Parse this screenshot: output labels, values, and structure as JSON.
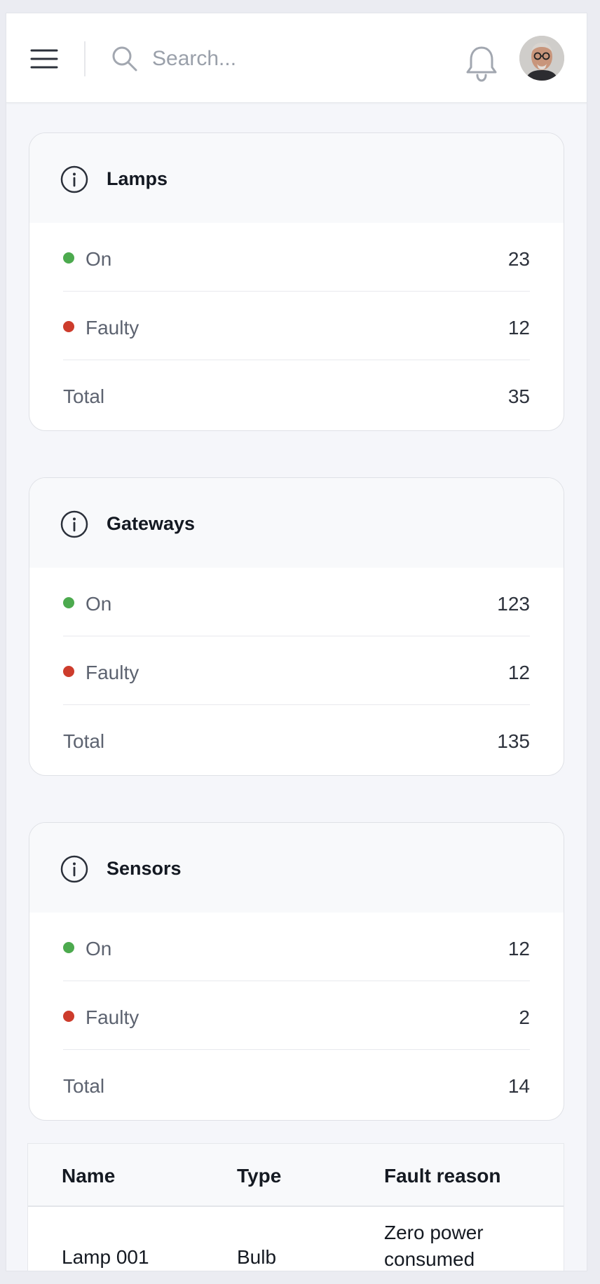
{
  "header": {
    "search_placeholder": "Search...",
    "menu_icon": "hamburger-menu-icon",
    "search_icon": "search-icon",
    "bell_icon": "bell-icon"
  },
  "colors": {
    "on": "#4caa4e",
    "faulty": "#cd3c2c",
    "page_bg": "#f5f6fa",
    "card_header_bg": "#f8f9fb"
  },
  "cards": [
    {
      "title": "Lamps",
      "icon": "info-icon",
      "rows": [
        {
          "label": "On",
          "value": "23"
        },
        {
          "label": "Faulty",
          "value": "12"
        },
        {
          "label": "Total",
          "value": "35"
        }
      ]
    },
    {
      "title": "Gateways",
      "icon": "info-icon",
      "rows": [
        {
          "label": "On",
          "value": "123"
        },
        {
          "label": "Faulty",
          "value": "12"
        },
        {
          "label": "Total",
          "value": "135"
        }
      ]
    },
    {
      "title": "Sensors",
      "icon": "info-icon",
      "rows": [
        {
          "label": "On",
          "value": "12"
        },
        {
          "label": "Faulty",
          "value": "2"
        },
        {
          "label": "Total",
          "value": "14"
        }
      ]
    }
  ],
  "table": {
    "headers": [
      "Name",
      "Type",
      "Fault reason"
    ],
    "rows": [
      [
        "Lamp 001",
        "Bulb",
        "Zero power consumed"
      ]
    ]
  }
}
